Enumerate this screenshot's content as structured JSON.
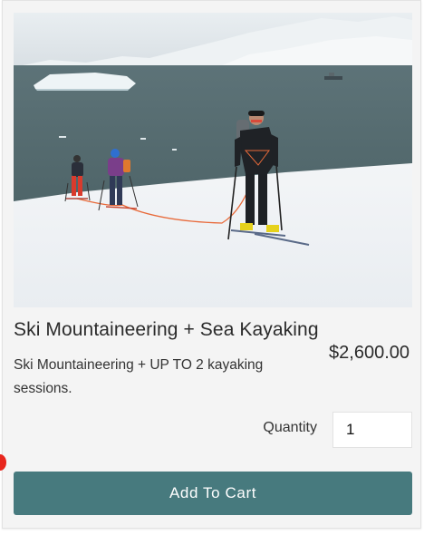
{
  "product": {
    "image_alt": "Skiers roped together on a snowy slope above the sea",
    "title": "Ski Mountaineering + Sea Kayaking",
    "price": "$2,600.00",
    "description": "Ski Mountaineering + UP TO 2 kayaking sessions."
  },
  "quantity": {
    "label": "Quantity",
    "value": "1"
  },
  "cart": {
    "add_label": "Add To Cart"
  },
  "colors": {
    "button": "#477a7e",
    "card_background": "#f4f4f4",
    "indicator": "#e8261d"
  }
}
